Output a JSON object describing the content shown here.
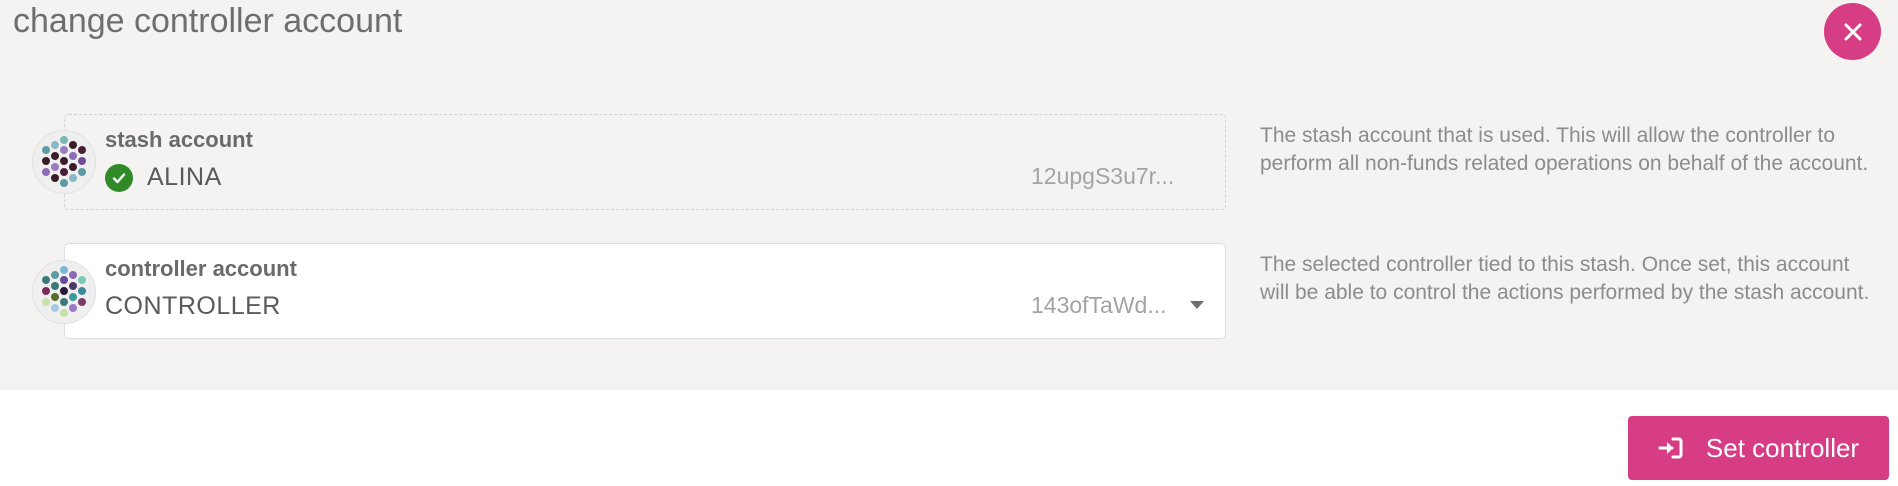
{
  "modal": {
    "title": "change controller account",
    "close_icon": "close-icon"
  },
  "stash": {
    "label": "stash account",
    "name": "ALINA",
    "address": "12upgS3u7r...",
    "verified_icon": "check-circle-icon",
    "help": "The stash account that is used. This will allow the controller to perform all non-funds related operations on behalf of the account."
  },
  "controller": {
    "label": "controller account",
    "name": "CONTROLLER",
    "address": "143ofTaWd...",
    "dropdown_icon": "caret-down-icon",
    "help": "The selected controller tied to this stash. Once set, this account will be able to control the actions performed by the stash account."
  },
  "actions": {
    "set_controller_label": "Set controller",
    "set_controller_icon": "sign-in-icon"
  },
  "colors": {
    "accent": "#d63d84",
    "verified": "#2f8a27",
    "panel_bg": "#f4f3f2"
  }
}
